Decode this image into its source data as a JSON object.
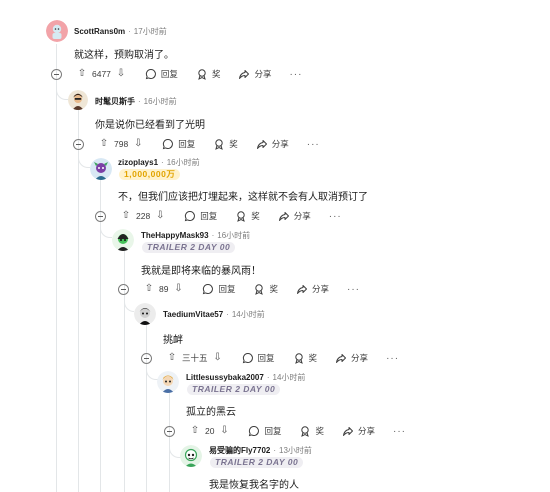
{
  "labels": {
    "reply": "回复",
    "award": "奖",
    "share": "分享",
    "dot": "·"
  },
  "comments": [
    {
      "username": "ScottRans0m",
      "time": "17小时前",
      "text": "就这样，预购取消了。",
      "votes": "6477"
    },
    {
      "username": "时髦贝斯手",
      "time": "16小时前",
      "text": "你是说你已经看到了光明",
      "votes": "798"
    },
    {
      "username": "zizoplays1",
      "time": "16小时前",
      "flair": "1,000,000万",
      "text": "不，但我们应该把灯埋起来，这样就不会有人取消预订了",
      "votes": "228"
    },
    {
      "username": "TheHappyMask93",
      "time": "16小时前",
      "flair": "TRAILER 2 DAY 00",
      "text": "我就是即将来临的暴风雨！",
      "votes": "89"
    },
    {
      "username": "TaediumVitae57",
      "time": "14小时前",
      "text": "挑衅",
      "votes": "三十五"
    },
    {
      "username": "Littlesussybaka2007",
      "time": "14小时前",
      "flair": "TRAILER 2 DAY 00",
      "text": "孤立的黑云",
      "votes": "20"
    },
    {
      "username": "易受骗的Fly7702",
      "time": "13小时前",
      "flair": "TRAILER 2 DAY 00",
      "text": "我是恢复我名字的人"
    }
  ]
}
